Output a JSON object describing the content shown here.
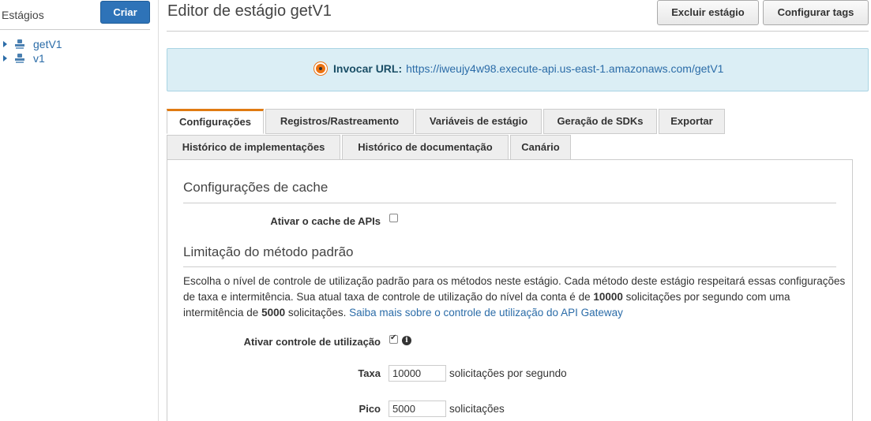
{
  "sidebar": {
    "title": "Estágios",
    "create_label": "Criar",
    "items": [
      {
        "label": "getV1"
      },
      {
        "label": "v1"
      }
    ]
  },
  "header": {
    "title": "Editor de estágio getV1",
    "delete_label": "Excluir estágio",
    "tags_label": "Configurar tags"
  },
  "invoke": {
    "label": "Invocar URL:",
    "url": "https://iweujy4w98.execute-api.us-east-1.amazonaws.com/getV1"
  },
  "tabs": {
    "row1": [
      "Configurações",
      "Registros/Rastreamento",
      "Variáveis de estágio",
      "Geração de SDKs",
      "Exportar"
    ],
    "row2": [
      "Histórico de implementações",
      "Histórico de documentação",
      "Canário"
    ]
  },
  "cache": {
    "title": "Configurações de cache",
    "enable_label": "Ativar o cache de APIs",
    "enabled": false
  },
  "throttle": {
    "title": "Limitação do método padrão",
    "desc_part1": "Escolha o nível de controle de utilização padrão para os métodos neste estágio. Cada método deste estágio respeitará essas configurações de taxa e intermitência. Sua atual taxa de controle de utilização do nível da conta é de ",
    "account_rate": "10000",
    "desc_part2": " solicitações por segundo com uma intermitência de ",
    "account_burst": "5000",
    "desc_part3": " solicitações. ",
    "learn_more": "Saiba mais sobre o controle de utilização do API Gateway",
    "enable_label": "Ativar controle de utilização",
    "enabled": true,
    "rate_label": "Taxa",
    "rate_value": "10000",
    "rate_unit": "solicitações por segundo",
    "burst_label": "Pico",
    "burst_value": "5000",
    "burst_unit": "solicitações"
  },
  "colors": {
    "primary_button": "#2e73b8",
    "active_tab_accent": "#e07b12",
    "info_box": "#dbeef5",
    "link": "#2b6ca8"
  }
}
